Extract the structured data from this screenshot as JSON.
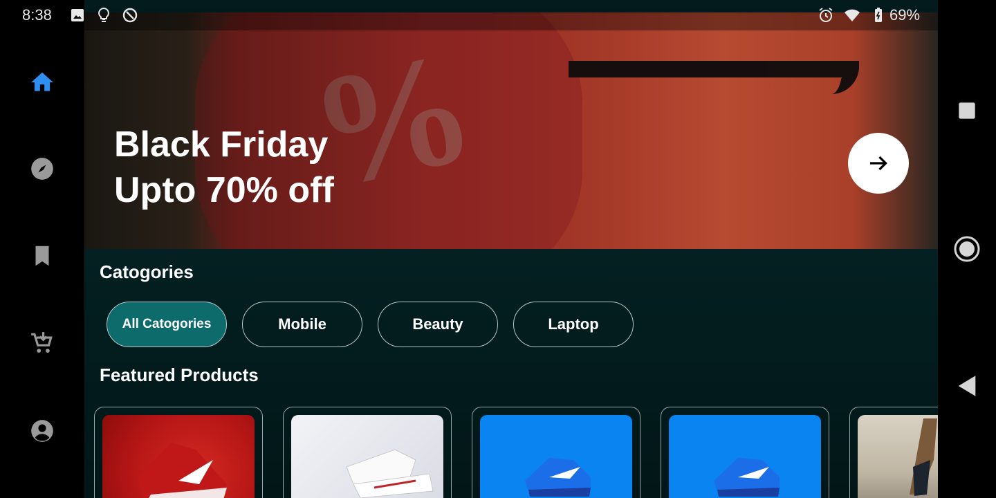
{
  "status_bar": {
    "time": "8:38",
    "battery": "69%",
    "left_icons": [
      "image-icon",
      "lightbulb-icon",
      "data-saver-icon"
    ],
    "right_icons": [
      "alarm-icon",
      "wifi-icon",
      "battery-icon"
    ]
  },
  "nav_rail": {
    "active_color": "#2f8ff0",
    "inactive_color": "#9a9a9a",
    "items": [
      {
        "name": "home",
        "icon": "home-icon",
        "active": true
      },
      {
        "name": "explore",
        "icon": "compass-icon",
        "active": false
      },
      {
        "name": "saved",
        "icon": "bookmark-icon",
        "active": false
      },
      {
        "name": "cart",
        "icon": "add-to-cart-icon",
        "active": false
      },
      {
        "name": "profile",
        "icon": "account-circle-icon",
        "active": false
      }
    ]
  },
  "banner": {
    "title_line1": "Black Friday",
    "title_line2": "Upto 70% off",
    "action_icon": "arrow-right-icon"
  },
  "categories": {
    "title": "Catogories",
    "accent": "#0d6b6b",
    "items": [
      {
        "label": "All Catogories",
        "selected": true
      },
      {
        "label": "Mobile",
        "selected": false
      },
      {
        "label": "Beauty",
        "selected": false
      },
      {
        "label": "Laptop",
        "selected": false
      }
    ]
  },
  "featured": {
    "title": "Featured Products",
    "products": [
      {
        "image": "red-sneaker"
      },
      {
        "image": "white-sneakers"
      },
      {
        "image": "blue-sneaker"
      },
      {
        "image": "blue-sneaker"
      },
      {
        "image": "high-heels-street"
      }
    ]
  },
  "system_nav": [
    "recents-square-icon",
    "home-circle-icon",
    "back-triangle-icon"
  ]
}
